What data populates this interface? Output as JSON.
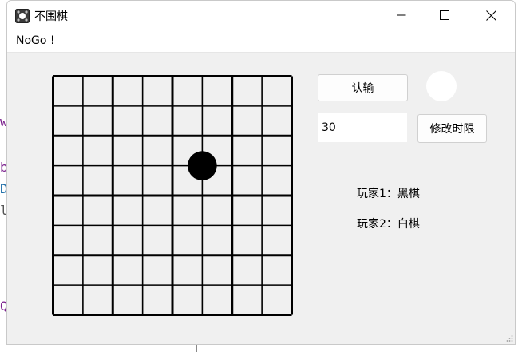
{
  "window": {
    "title": "不围棋",
    "menu_title": "NoGo !"
  },
  "board": {
    "size": 8,
    "stones": [
      {
        "row": 3,
        "col": 5,
        "color": "#000000"
      }
    ]
  },
  "controls": {
    "resign_label": "认输",
    "time_limit_value": "30",
    "change_time_label": "修改时限",
    "turn_color": "#ffffff"
  },
  "players": {
    "player1": "玩家1：黑棋",
    "player2": "玩家2：白棋"
  },
  "icons": {
    "app": "nogo-app-icon",
    "minimize": "minimize-icon",
    "maximize": "maximize-icon",
    "close": "close-icon"
  }
}
